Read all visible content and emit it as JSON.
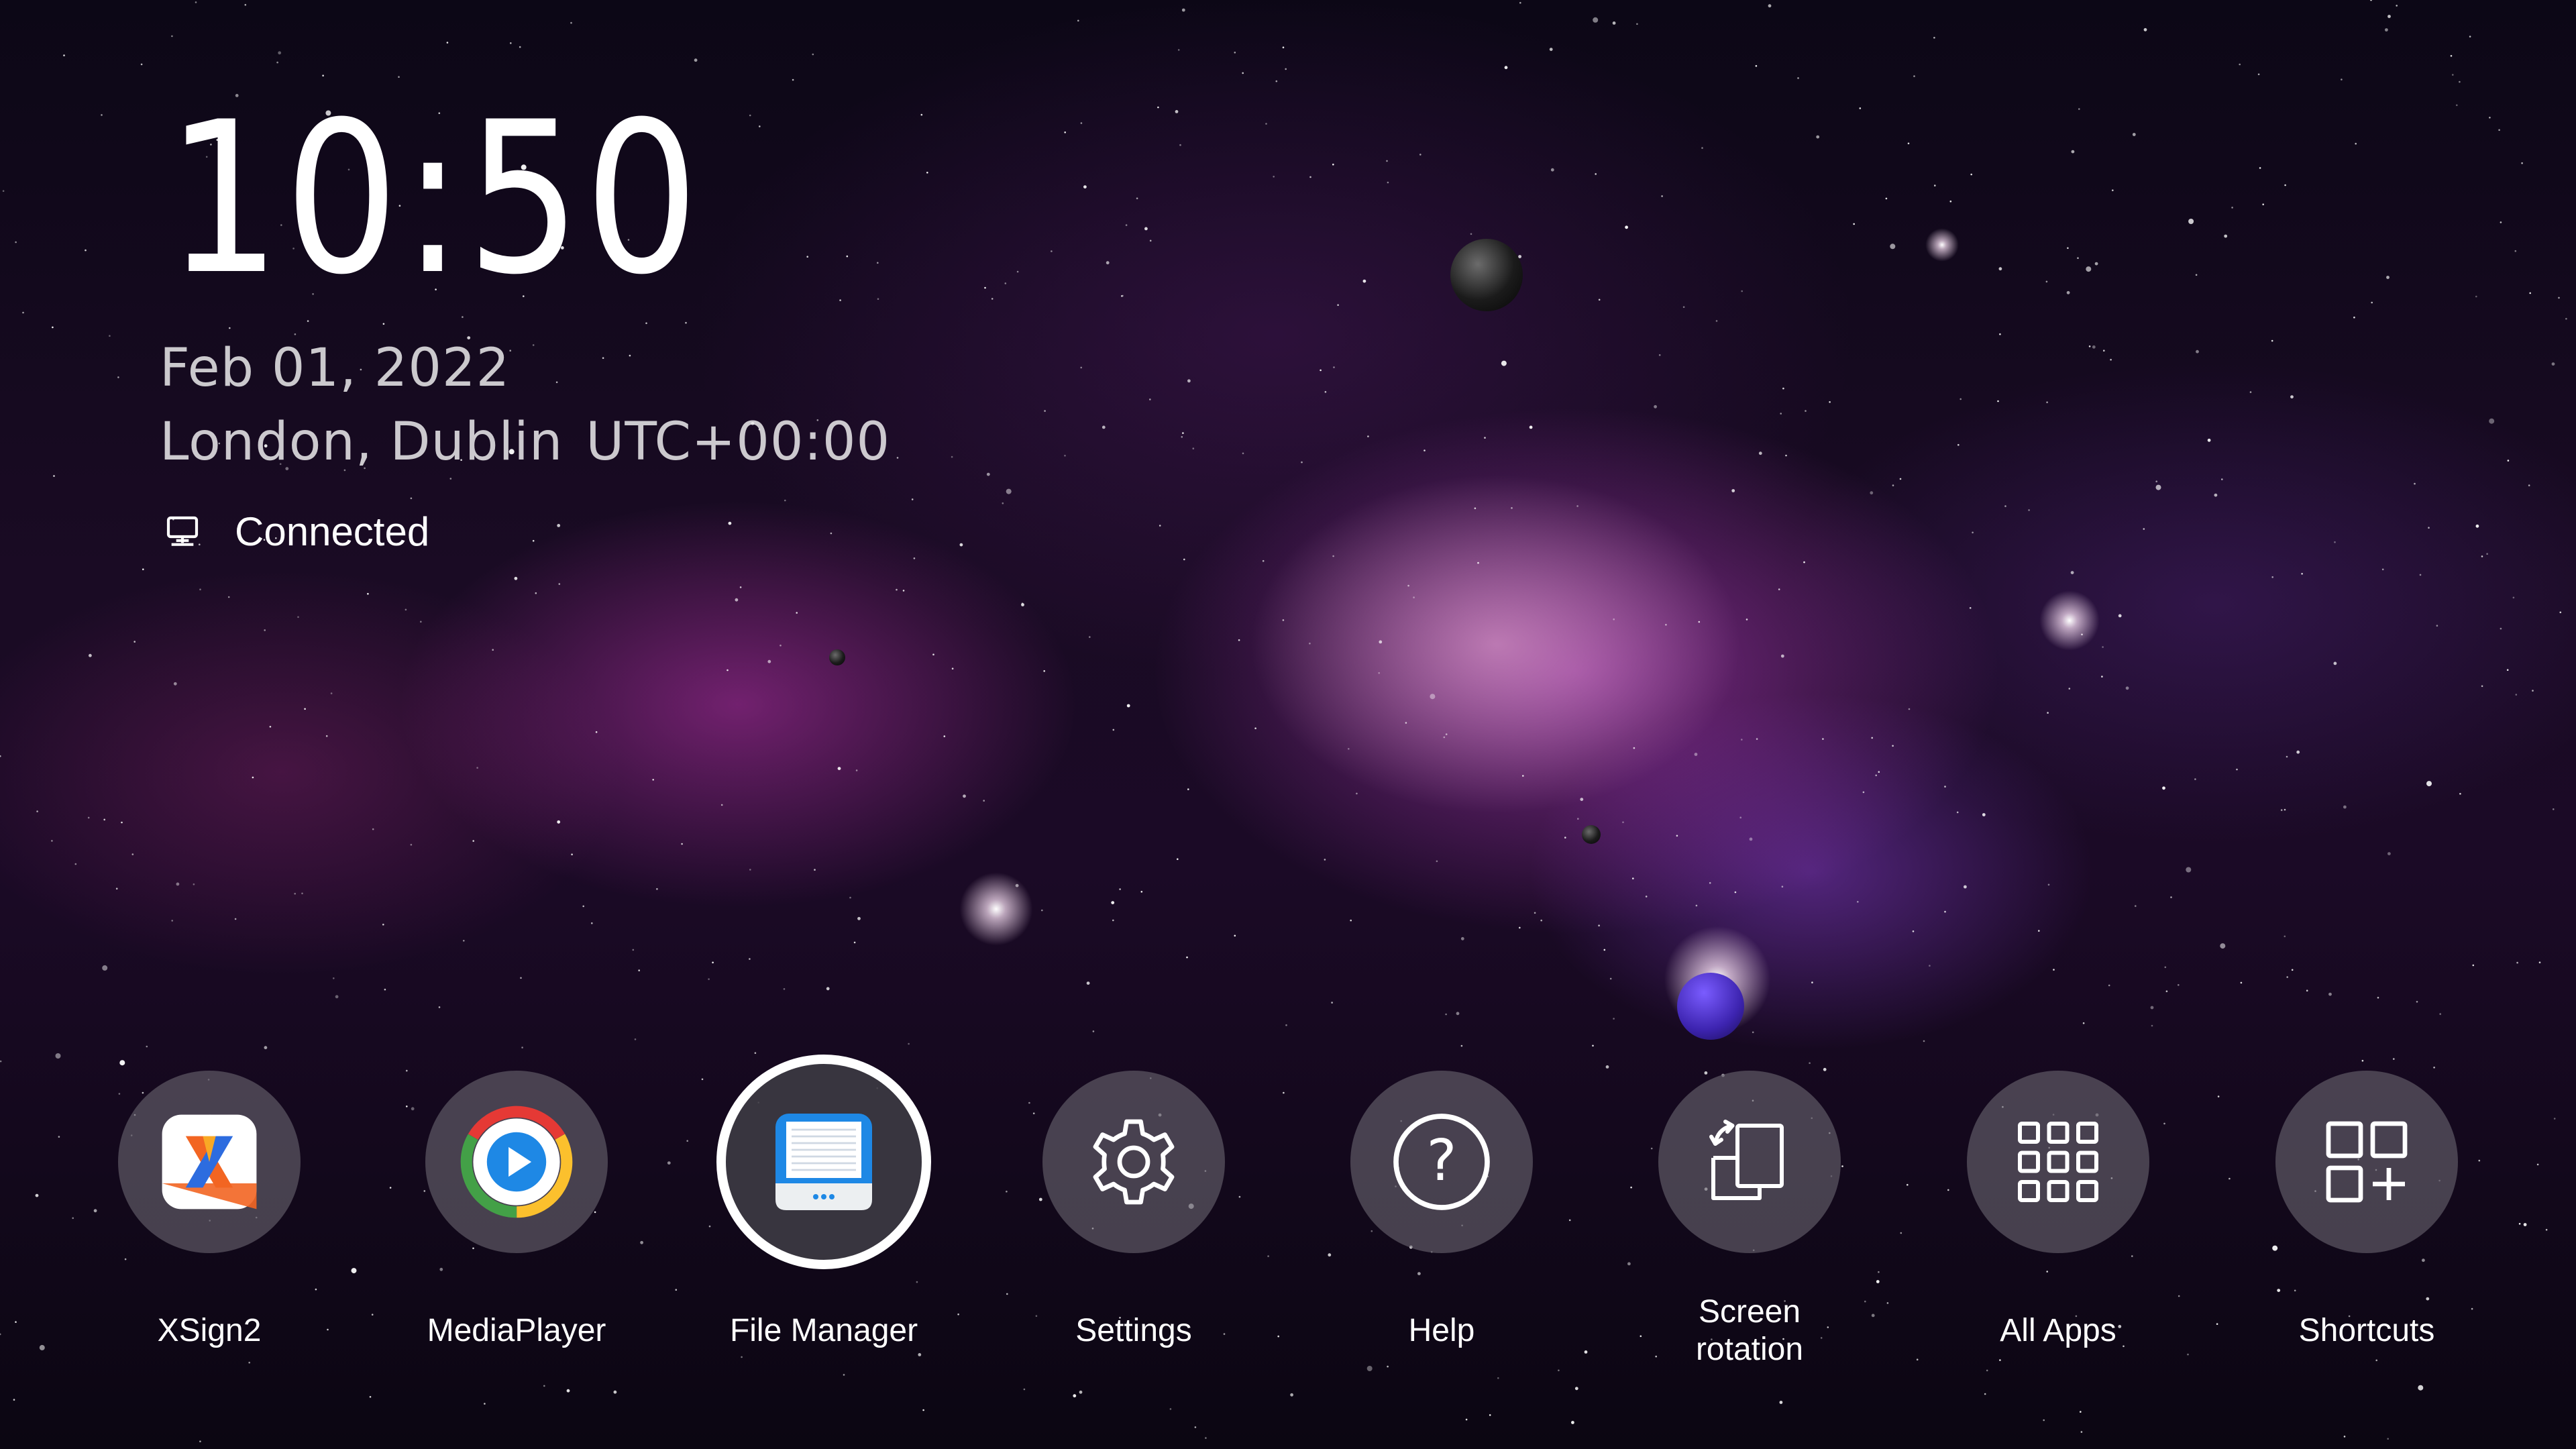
{
  "clock": {
    "time": "10:50"
  },
  "date": "Feb 01, 2022",
  "timezone": {
    "city": "London, Dublin",
    "offset": "UTC+00:00"
  },
  "network": {
    "status": "Connected",
    "icon": "monitor-network-icon"
  },
  "apps": [
    {
      "id": "xsign2",
      "label": "XSign2",
      "icon": "xsign2-logo-icon"
    },
    {
      "id": "mediaplayer",
      "label": "MediaPlayer",
      "icon": "play-icon"
    },
    {
      "id": "file-manager",
      "label": "File Manager",
      "icon": "folder-icon",
      "focused": true
    },
    {
      "id": "settings",
      "label": "Settings",
      "icon": "gear-icon"
    },
    {
      "id": "help",
      "label": "Help",
      "icon": "question-icon"
    },
    {
      "id": "screen-rotation",
      "label_line1": "Screen",
      "label_line2": "rotation",
      "icon": "screen-rotation-icon"
    },
    {
      "id": "all-apps",
      "label": "All Apps",
      "icon": "grid-icon"
    },
    {
      "id": "shortcuts",
      "label": "Shortcuts",
      "icon": "add-shortcut-icon"
    }
  ],
  "colors": {
    "focus_ring": "#ffffff",
    "xsign_orange": "#f26522",
    "xsign_blue": "#2d6cdf",
    "media_play": "#1e88e5",
    "media_ring_red": "#e53935",
    "media_ring_yellow": "#fbc02d",
    "media_ring_green": "#43a047",
    "file_blue": "#1e88e5"
  }
}
